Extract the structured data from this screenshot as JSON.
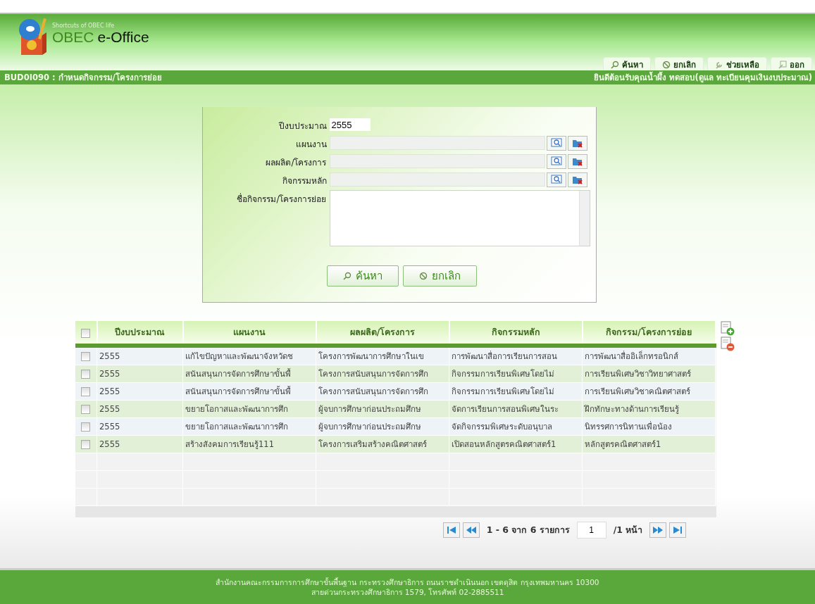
{
  "header": {
    "tagline": "Shortcuts of OBEC life",
    "brand_first": "OBEC",
    "brand_second": "e-Office",
    "nav": [
      {
        "label": "ค้นหา",
        "kind": "search"
      },
      {
        "label": "ยกเลิก",
        "kind": "cancel"
      },
      {
        "label": "ช่วยเหลือ",
        "kind": "help"
      },
      {
        "label": "ออก",
        "kind": "exit"
      }
    ]
  },
  "title_bar": {
    "page_title": "BUD0I090 : กำหนดกิจกรรม/โครงการย่อย",
    "welcome": "ยินดีต้อนรับคุณน้ำผึ้ง ทดสอบ(ดูแล ทะเบียนคุมเงินงบประมาณ)"
  },
  "form": {
    "fields": [
      {
        "kind": "text",
        "label": "ปีงบประมาณ",
        "value": "2555"
      },
      {
        "kind": "lookup",
        "label": "แผนงาน"
      },
      {
        "kind": "lookup",
        "label": "ผลผลิต/โครงการ"
      },
      {
        "kind": "lookup",
        "label": "กิจกรรมหลัก"
      },
      {
        "kind": "textarea",
        "label": "ชื่อกิจกรรม/โครงการย่อย"
      }
    ],
    "buttons": [
      {
        "label": "ค้นหา",
        "kind": "search"
      },
      {
        "label": "ยกเลิก",
        "kind": "cancel"
      }
    ]
  },
  "table": {
    "all_checked": false,
    "columns": [
      "ปีงบประมาณ",
      "แผนงาน",
      "ผลผลิต/โครงการ",
      "กิจกรรมหลัก",
      "กิจกรรม/โครงการย่อย"
    ],
    "rows": [
      {
        "checked": false,
        "cells": [
          "2555",
          "แก้ไขปัญหาและพัฒนาจังหวัดช",
          "โครงการพัฒนาการศึกษาในเข",
          "การพัฒนาสื่อการเรียนการสอน",
          "การพัฒนาสื่ออิเล็กทรอนิกส์"
        ]
      },
      {
        "checked": false,
        "cells": [
          "2555",
          "สนันสนุนการจัดการศึกษาขั้นพื้",
          "โครงการสนับสนุนการจัดการศึก",
          "กิจกรรมการเรียนพิเศษโดยไม่",
          "การเรียนพิเศษวิชาวิทยาศาสตร์"
        ]
      },
      {
        "checked": false,
        "cells": [
          "2555",
          "สนันสนุนการจัดการศึกษาขั้นพื้",
          "โครงการสนับสนุนการจัดการศึก",
          "กิจกรรมการเรียนพิเศษโดยไม่",
          "การเรียนพิเศษวิชาคณิตศาสตร์"
        ]
      },
      {
        "checked": false,
        "cells": [
          "2555",
          "ขยายโอกาสและพัฒนาการศึก",
          "ผู้จบการศึกษาก่อนประถมศึกษ",
          "จัดการเรียนการสอนพิเศษในระ",
          "ฝึกทักษะทางด้านการเรียนรู้"
        ]
      },
      {
        "checked": false,
        "cells": [
          "2555",
          "ขยายโอกาสและพัฒนาการศึก",
          "ผู้จบการศึกษาก่อนประถมศึกษ",
          "จัดกิจกรรมพิเศษระดับอนุบาล",
          "นิทรรศการนิทานเพื่อน้อง"
        ]
      },
      {
        "checked": false,
        "cells": [
          "2555",
          "สร้างสังคมการเรียนรู้111",
          "โครงการเสริมสร้างคณิตศาสตร์",
          "เปิดสอนหลักสูตรคณิตศาสตร์1",
          "หลักสูตรคณิตศาสตร์1"
        ]
      }
    ]
  },
  "pager": {
    "range": "1 - 6 จาก 6 รายการ",
    "page": "1",
    "total": "/1 หน้า"
  },
  "footer": {
    "lines": [
      "สำนักงานคณะกรรมการการศึกษาขั้นพื้นฐาน กระทรวงศึกษาธิการ ถนนราชดำเนินนอก เขตดุสิต กรุงเทพมหานคร 10300",
      "สายด่วนกระทรวงศึกษาธิการ 1579, โทรศัพท์ 02-2885511"
    ]
  }
}
